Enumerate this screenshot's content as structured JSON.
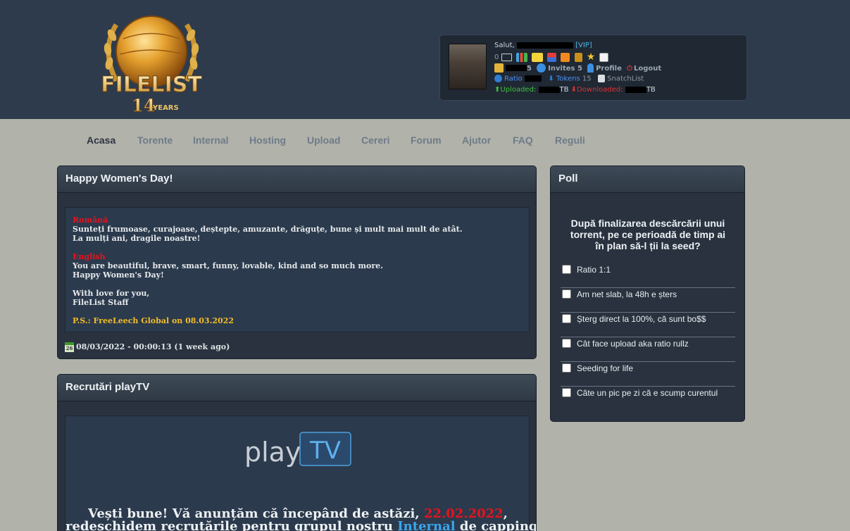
{
  "header": {
    "logo": {
      "name": "FILELIST",
      "years": "14",
      "years_label": "YEARS"
    },
    "user": {
      "greeting": "Salut,",
      "class": "[VIP]",
      "messages_count": "0",
      "bonus_suffix": "5",
      "invites": "Invites 5",
      "profile": "Profile",
      "logout": "Logout",
      "ratio_label": "Ratio",
      "tokens_label": "Tokens",
      "tokens_value": "15",
      "snatchlist": "SnatchList",
      "uploaded_label": "Uploaded:",
      "uploaded_unit": "TB",
      "downloaded_label": "Downloaded:",
      "downloaded_unit": "TB"
    }
  },
  "nav": [
    "Acasa",
    "Torente",
    "Internal",
    "Hosting",
    "Upload",
    "Cereri",
    "Forum",
    "Ajutor",
    "FAQ",
    "Reguli"
  ],
  "news": [
    {
      "title": "Happy Women's Day!",
      "ro_heading": "Română",
      "ro_line1": "Sunteți frumoase, curajoase, deștepte, amuzante, drăguțe, bune și mult mai mult de atât.",
      "ro_line2": "La mulți ani, dragile noastre!",
      "en_heading": "English",
      "en_line1": "You are beautiful, brave, smart, funny, lovable, kind and so much more.",
      "en_line2": "Happy Women's Day!",
      "sign1": "With love for you,",
      "sign2": "FileList Staff",
      "ps": "P.S.: FreeLeech Global on 08.03.2022",
      "calendar_day": "26",
      "date": "08/03/2022 - 00:00:13 (1 week ago)"
    },
    {
      "title": "Recrutări playTV",
      "logo_play": "play",
      "logo_tv": "TV",
      "line1_a": "Vești bune! Vă anunțăm că începând de astăzi, ",
      "line1_date": "22.02.2022",
      "line1_b": ",",
      "line2_a": "redeschidem recrutările pentru grupul nostru ",
      "line2_link": "Internal",
      "line2_b": " de capping."
    }
  ],
  "poll": {
    "title": "Poll",
    "question": "După finalizarea descărcării unui torrent, pe ce perioadă de timp ai în plan să-l ții la seed?",
    "options": [
      "Ratio 1:1",
      "Am net slab, la 48h e șters",
      "Șterg direct la 100%, că sunt bo$$",
      "Cât face upload aka ratio rullz",
      "Seeding for life",
      "Câte un pic pe zi că e scump curentul"
    ]
  }
}
